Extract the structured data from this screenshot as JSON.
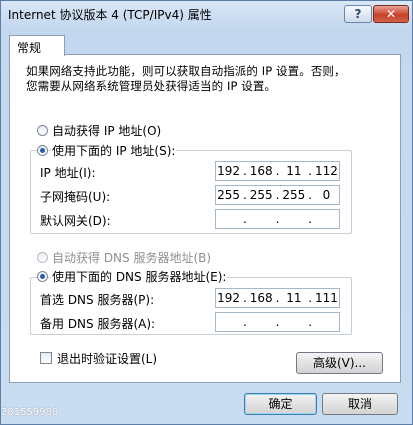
{
  "window": {
    "title": "Internet 协议版本 4 (TCP/IPv4) 属性",
    "help_label": "?",
    "close_label": "✕"
  },
  "tab": {
    "label": "常规"
  },
  "description": {
    "line1": "如果网络支持此功能，则可以获取自动指派的 IP 设置。否则，",
    "line2": "您需要从网络系统管理员处获得适当的 IP 设置。"
  },
  "ip": {
    "auto_label": "自动获得 IP 地址(O)",
    "manual_label": "使用下面的 IP 地址(S):",
    "address_label": "IP 地址(I):",
    "address": [
      "192",
      "168",
      "11",
      "112"
    ],
    "subnet_label": "子网掩码(U):",
    "subnet": [
      "255",
      "255",
      "255",
      "0"
    ],
    "gateway_label": "默认网关(D):",
    "gateway": [
      "",
      "",
      "",
      ""
    ]
  },
  "dns": {
    "auto_label": "自动获得 DNS 服务器地址(B)",
    "manual_label": "使用下面的 DNS 服务器地址(E):",
    "preferred_label": "首选 DNS 服务器(P):",
    "preferred": [
      "192",
      "168",
      "11",
      "111"
    ],
    "alternate_label": "备用 DNS 服务器(A):",
    "alternate": [
      "",
      "",
      "",
      ""
    ]
  },
  "validate_label": "退出时验证设置(L)",
  "advanced_label": "高级(V)...",
  "ok_label": "确定",
  "cancel_label": "取消",
  "watermark": "281559980"
}
